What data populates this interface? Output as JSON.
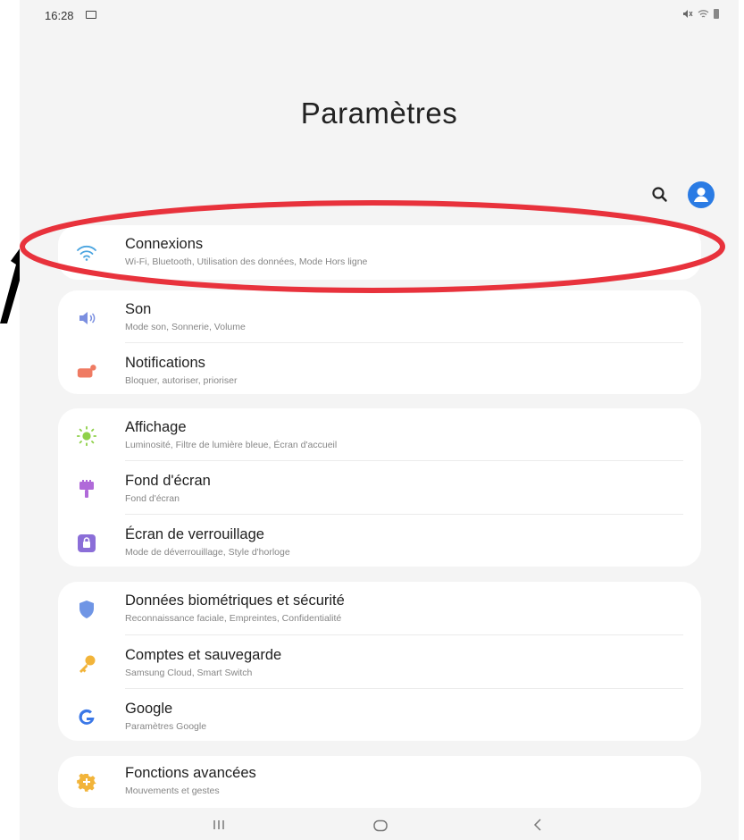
{
  "status": {
    "time": "16:28"
  },
  "header": {
    "title": "Paramètres"
  },
  "groups": [
    {
      "items": [
        {
          "title": "Connexions",
          "subtitle": "Wi-Fi, Bluetooth, Utilisation des données, Mode Hors ligne",
          "icon": "wifi-icon",
          "color": "#4aa4e0"
        }
      ]
    },
    {
      "items": [
        {
          "title": "Son",
          "subtitle": "Mode son, Sonnerie, Volume",
          "icon": "speaker-icon",
          "color": "#7b8fe0"
        },
        {
          "title": "Notifications",
          "subtitle": "Bloquer, autoriser, prioriser",
          "icon": "notifications-icon",
          "color": "#ef7b63"
        }
      ]
    },
    {
      "items": [
        {
          "title": "Affichage",
          "subtitle": "Luminosité, Filtre de lumière bleue, Écran d'accueil",
          "icon": "brightness-icon",
          "color": "#8fd14a"
        },
        {
          "title": "Fond d'écran",
          "subtitle": "Fond d'écran",
          "icon": "wallpaper-brush-icon",
          "color": "#b06ad9"
        },
        {
          "title": "Écran de verrouillage",
          "subtitle": "Mode de déverrouillage, Style d'horloge",
          "icon": "lock-icon",
          "color": "#8b6ed8"
        }
      ]
    },
    {
      "items": [
        {
          "title": "Données biométriques et sécurité",
          "subtitle": "Reconnaissance faciale, Empreintes, Confidentialité",
          "icon": "shield-icon",
          "color": "#6f95e5"
        },
        {
          "title": "Comptes et sauvegarde",
          "subtitle": "Samsung Cloud, Smart Switch",
          "icon": "key-icon",
          "color": "#f2b43a"
        },
        {
          "title": "Google",
          "subtitle": "Paramètres Google",
          "icon": "google-icon",
          "color": "#3b78e7"
        }
      ]
    },
    {
      "items": [
        {
          "title": "Fonctions avancées",
          "subtitle": "Mouvements et gestes",
          "icon": "gear-plus-icon",
          "color": "#f2b43a"
        }
      ]
    }
  ],
  "annotation": {
    "ellipse_color": "#e8323c",
    "arrow_color": "#000000"
  },
  "accent": "#2a7be4"
}
